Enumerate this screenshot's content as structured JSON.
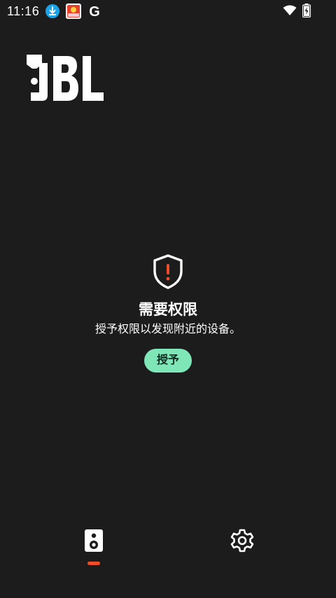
{
  "status_bar": {
    "time": "11:16",
    "icons": [
      "download-icon",
      "app-notification-icon",
      "google-icon",
      "wifi-icon",
      "battery-charging-icon"
    ],
    "google_glyph": "G"
  },
  "logo": {
    "text": "JBL"
  },
  "permission": {
    "title": "需要权限",
    "message": "授予权限以发现附近的设备。",
    "button_label": "授予",
    "icon": "shield-alert-icon"
  },
  "bottom_nav": {
    "items": [
      {
        "icon": "speaker-icon",
        "selected": true
      },
      {
        "icon": "gear-icon",
        "selected": false
      }
    ]
  },
  "colors": {
    "background": "#1c1c1d",
    "accent_button": "#7fe6b8",
    "alert_red": "#ef4d2a",
    "download_badge": "#1aa3e8"
  }
}
